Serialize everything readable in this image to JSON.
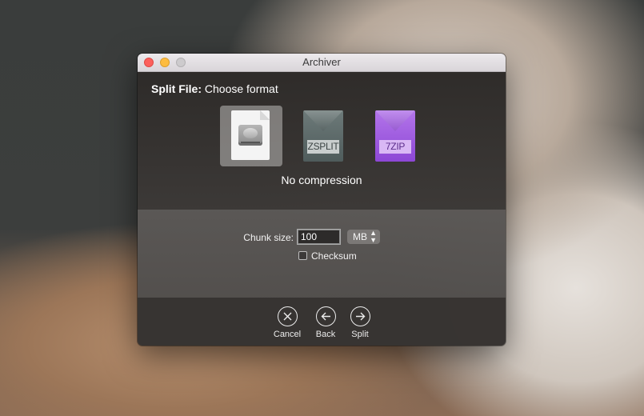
{
  "window": {
    "title": "Archiver"
  },
  "step": {
    "title_bold": "Split File:",
    "title_rest": " Choose format"
  },
  "formats": [
    {
      "name": "No compression",
      "icon": "disk-document-icon",
      "selected": true
    },
    {
      "name": "ZSPLIT",
      "icon": "zsplit-envelope-icon",
      "selected": false,
      "badge": "ZSPLIT"
    },
    {
      "name": "7ZIP",
      "icon": "7zip-envelope-icon",
      "selected": false,
      "badge": "7ZIP"
    }
  ],
  "selected_format_label": "No compression",
  "options": {
    "chunk_size_label": "Chunk size:",
    "chunk_size_value": "100",
    "unit": "MB",
    "checksum_label": "Checksum",
    "checksum_checked": false
  },
  "buttons": {
    "cancel": "Cancel",
    "back": "Back",
    "split": "Split"
  },
  "colors": {
    "zsplit": "#5e6b6a",
    "zip7": "#9f5be0",
    "close": "#fc605c",
    "minimize": "#fdbc40"
  }
}
